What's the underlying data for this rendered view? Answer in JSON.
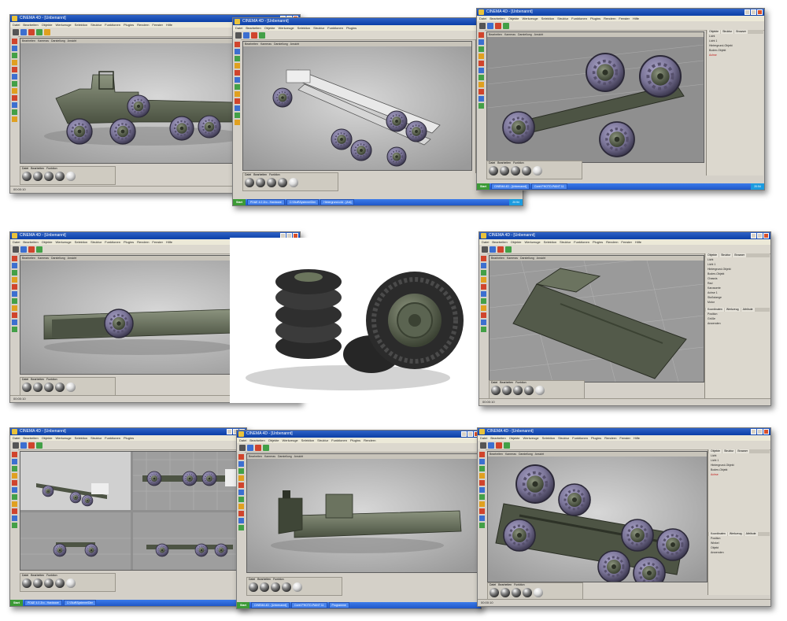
{
  "cinema": {
    "window_title": "CINEMA 4D - [Unbenannt]",
    "menu": [
      "Datei",
      "Bearbeiten",
      "Objekte",
      "Werkzeuge",
      "Selektion",
      "Struktur",
      "Funktionen",
      "Plugins",
      "Rendern",
      "Fenster",
      "Hilfe"
    ],
    "viewport_menu": [
      "Bearbeiten",
      "Kameras",
      "Darstellung",
      "Ansicht"
    ],
    "material_menu": [
      "Datei",
      "Bearbeiten",
      "Funktion"
    ],
    "status_time": "00:00:10"
  },
  "taskbar": {
    "start_label": "Start",
    "items": [
      "PD&E 4.0 Zro - Hardware",
      "C:\\Stuff\\Systeme\\Dim",
      "Hintergrund.c4d - [Ant]",
      "CINEMA 4D - [Unbenannt]",
      "Corel PHOTO-PAINT 11"
    ],
    "programs_label": "Programme",
    "clock": "20:54"
  },
  "object_panel": {
    "tabs": [
      "Objekte",
      "Struktur",
      "Browser",
      "Farben",
      "Pixel"
    ],
    "items": [
      "Licht",
      "Licht 1",
      "Hintergrund-Objekt",
      "Boden-Objekt",
      "Achse",
      "Chassis",
      "Rad",
      "Karosserie",
      "Achse 1",
      "Stoßstange",
      "Motor"
    ],
    "attr_tabs": [
      "Koordinaten",
      "Werkzeug",
      "Attribute"
    ],
    "attr_labels": [
      "Position",
      "Größe",
      "Winkel",
      "Objekt",
      "Anwenden"
    ]
  },
  "colors": {
    "vehicle_body": "#5b6451",
    "tire": "#7b7596",
    "viewport_bg": "#b7b7b7",
    "title_blue": "#0b3fa6"
  },
  "icons": [
    "cinema4d-app-icon",
    "minimize-icon",
    "maximize-icon",
    "close-icon",
    "move-tool-icon",
    "scale-tool-icon",
    "rotate-tool-icon",
    "render-icon",
    "material-ball-icon"
  ]
}
